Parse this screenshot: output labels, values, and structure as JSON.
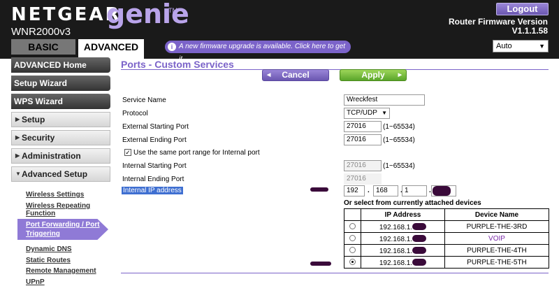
{
  "header": {
    "brand": "NETGEAR",
    "product": "genie",
    "trademark": "TM",
    "model": "WNR2000v3",
    "logout_label": "Logout",
    "firmware_label": "Router Firmware Version",
    "firmware_version": "V1.1.1.58",
    "tabs": [
      {
        "label": "BASIC"
      },
      {
        "label": "ADVANCED"
      }
    ],
    "upgrade_notice": "A new firmware upgrade is available. Click here to get it.",
    "language": "Auto"
  },
  "sidebar": {
    "advanced_home": "ADVANCED Home",
    "setup_wizard": "Setup Wizard",
    "wps_wizard": "WPS Wizard",
    "setup": "Setup",
    "security": "Security",
    "administration": "Administration",
    "advanced_setup": "Advanced Setup",
    "sub": {
      "wireless_settings": "Wireless Settings",
      "wireless_repeating_1": "Wireless Repeating",
      "wireless_repeating_2": "Function",
      "port_forwarding_1": "Port Forwarding / Port",
      "port_forwarding_2": "Triggering",
      "dynamic_dns": "Dynamic DNS",
      "static_routes": "Static Routes",
      "remote_management": "Remote Management",
      "upnp": "UPnP"
    }
  },
  "page": {
    "title": "Ports - Custom Services",
    "cancel_label": "Cancel",
    "apply_label": "Apply"
  },
  "form": {
    "service_name_label": "Service Name",
    "service_name": "Wreckfest",
    "protocol_label": "Protocol",
    "protocol": "TCP/UDP",
    "ext_start_label": "External Starting Port",
    "ext_start": "27016",
    "ext_end_label": "External Ending Port",
    "ext_end": "27016",
    "range_hint": "(1~65534)",
    "same_range_label": "Use the same port range for Internal port",
    "same_range_checked": true,
    "int_start_label": "Internal Starting Port",
    "int_start": "27016",
    "int_end_label": "Internal Ending Port",
    "int_end": "27016",
    "ip_label": "Internal IP address",
    "ip_octets": [
      "192",
      "168",
      "1",
      ""
    ],
    "dot": ".",
    "or_select_label": "Or select from currently attached devices"
  },
  "devices": {
    "columns": [
      "",
      "IP Address",
      "Device Name"
    ],
    "rows": [
      {
        "ip": "192.168.1.",
        "name": "PURPLE-THE-3RD",
        "selected": false,
        "name_color": "#000000"
      },
      {
        "ip": "192.168.1.",
        "name": "VOIP",
        "selected": false,
        "name_color": "#7a2aa8"
      },
      {
        "ip": "192.168.1.",
        "name": "PURPLE-THE-4TH",
        "selected": false,
        "name_color": "#000000"
      },
      {
        "ip": "192.168.1.",
        "name": "PURPLE-THE-5TH",
        "selected": true,
        "name_color": "#000000"
      }
    ]
  },
  "colors": {
    "accent": "#7b63c9",
    "header_bg": "#1a1a1a",
    "apply_green": "#5aa52a",
    "redaction": "#3a0a3a"
  }
}
